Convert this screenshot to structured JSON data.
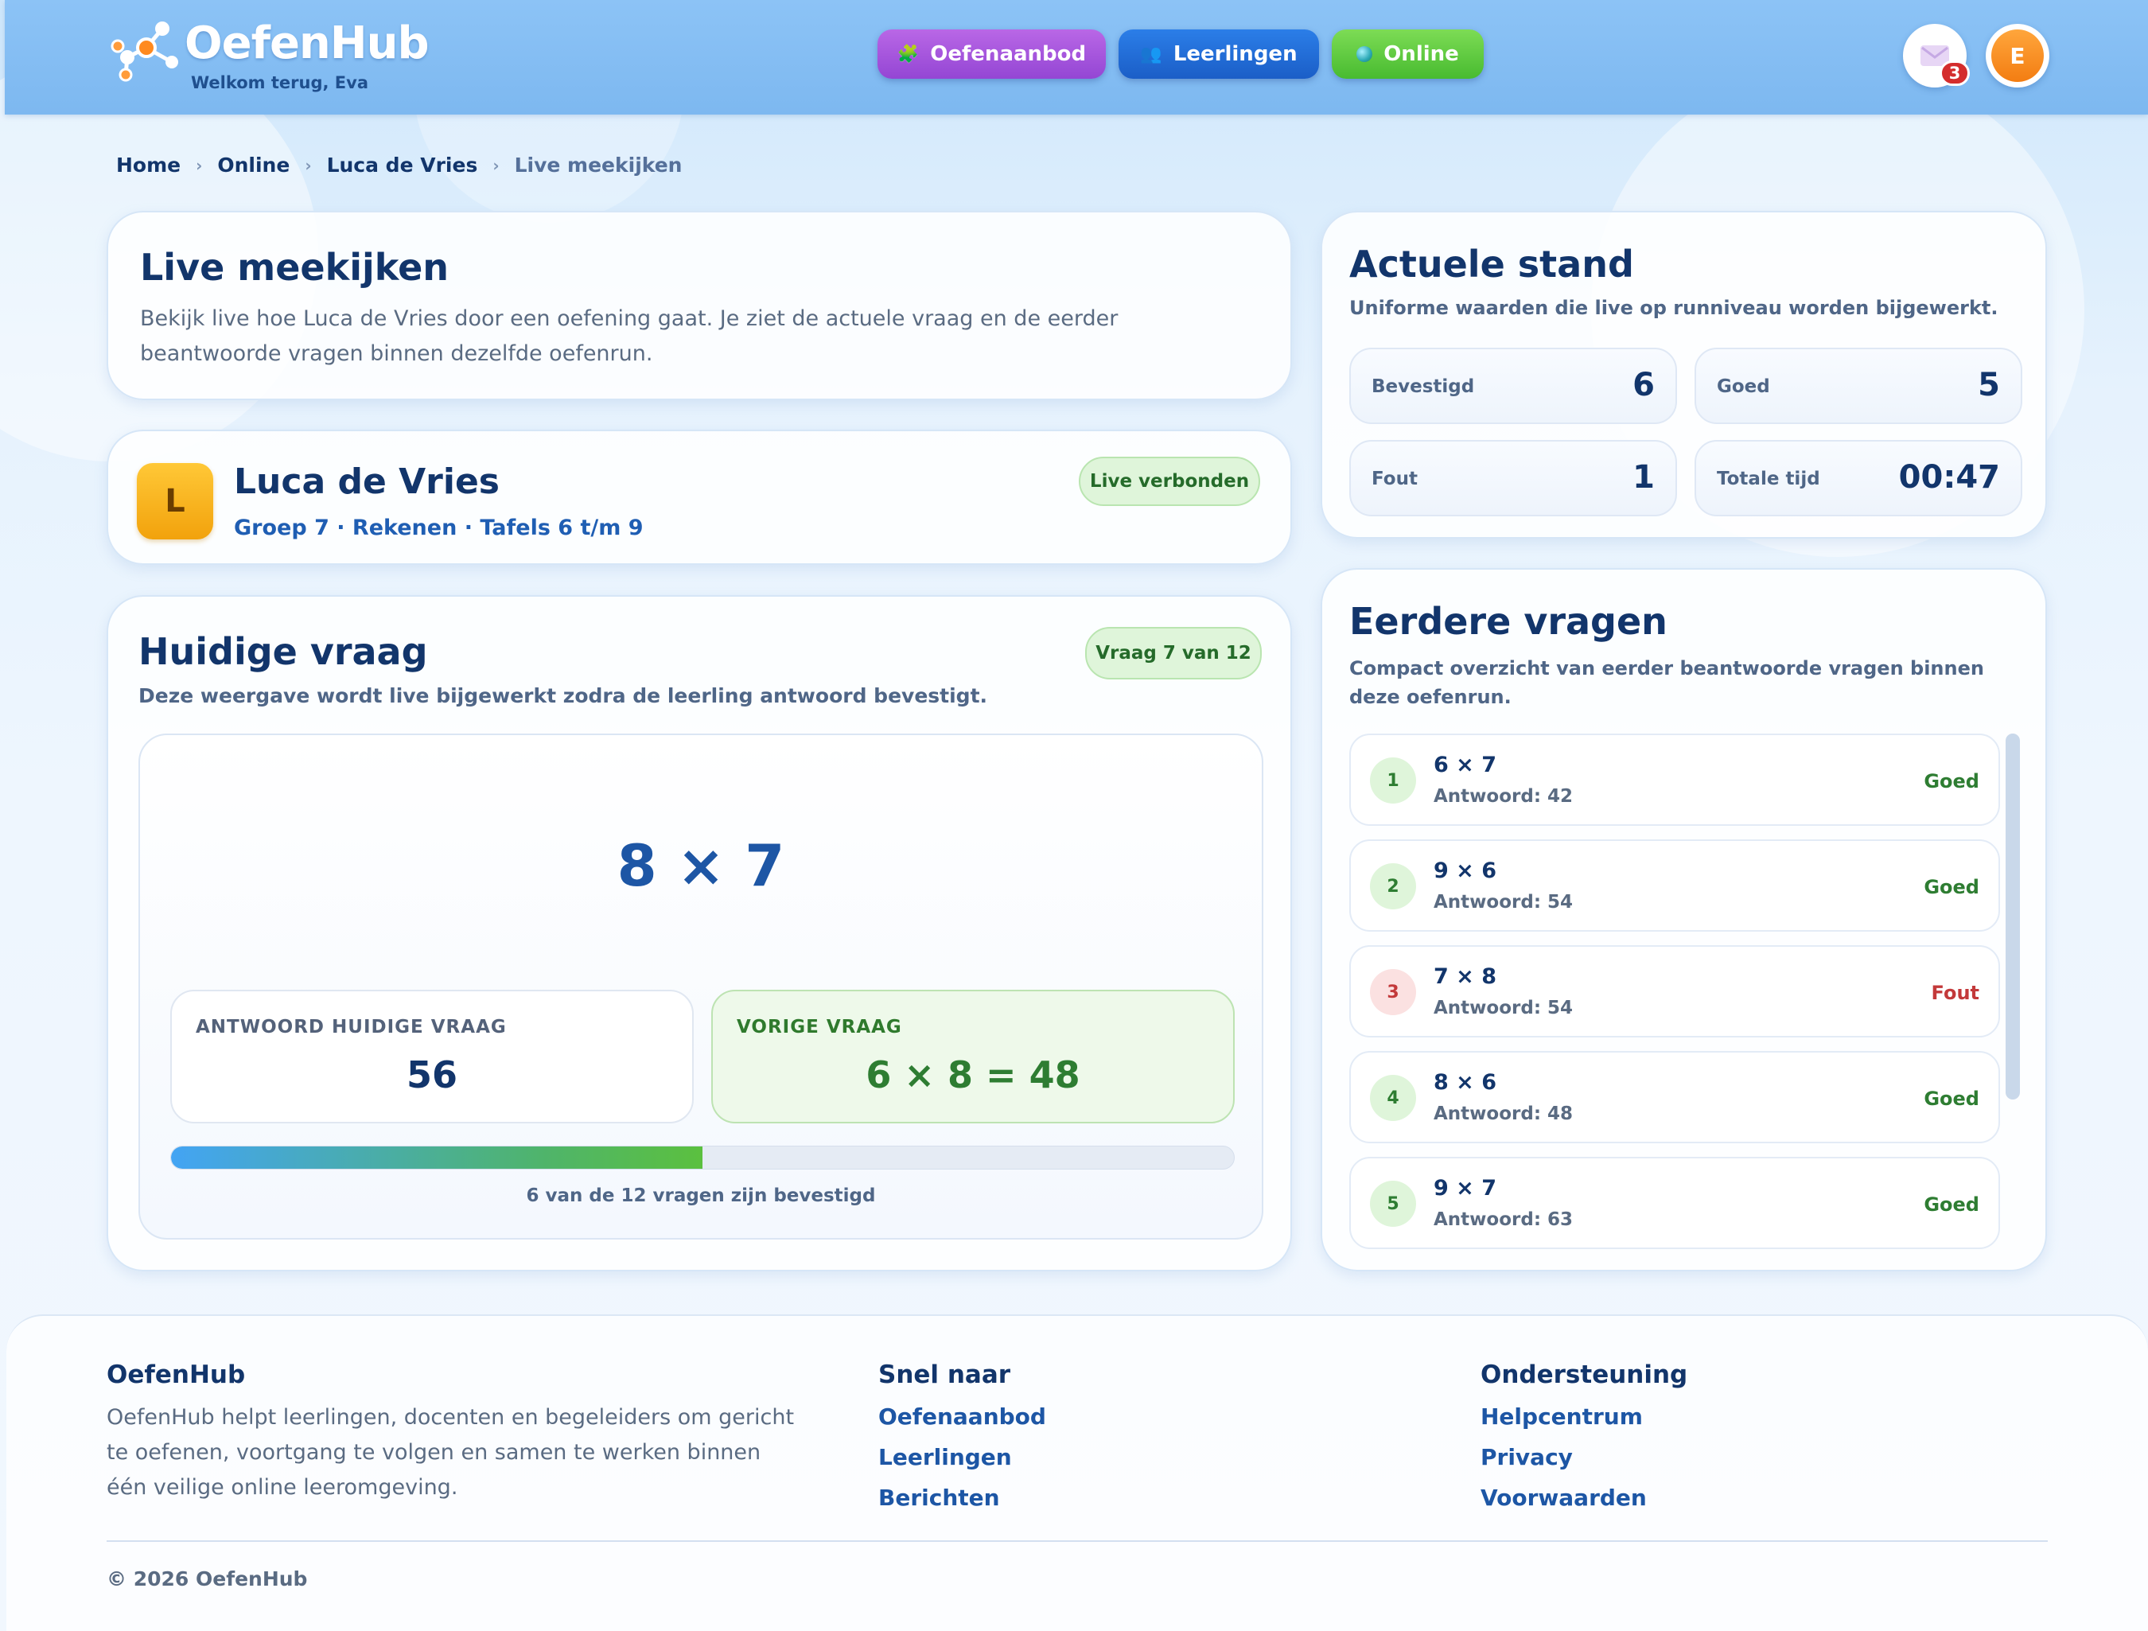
{
  "header": {
    "brand": "OefenHub",
    "welcome": "Welkom terug, Eva",
    "nav": [
      {
        "label": "Oefenaanbod",
        "icon": "puzzle-icon"
      },
      {
        "label": "Leerlingen",
        "icon": "people-icon"
      },
      {
        "label": "Online",
        "icon": "online-dot-icon"
      }
    ],
    "messages_count": "3",
    "avatar_initial": "E"
  },
  "breadcrumb": [
    "Home",
    "Online",
    "Luca de Vries",
    "Live meekijken"
  ],
  "intro": {
    "title": "Live meekijken",
    "text": "Bekijk live hoe Luca de Vries door een oefening gaat. Je ziet de actuele vraag en de eerder beantwoorde vragen binnen dezelfde oefenrun."
  },
  "student": {
    "initial": "L",
    "name": "Luca de Vries",
    "meta": "Groep 7 · Rekenen · Tafels 6 t/m 9",
    "status": "Live verbonden"
  },
  "current_question": {
    "title": "Huidige vraag",
    "subtitle": "Deze weergave wordt live bijgewerkt zodra de leerling antwoord bevestigt.",
    "counter": "Vraag 7 van 12",
    "expression": "8 × 7",
    "answer_label": "ANTWOORD HUIDIGE VRAAG",
    "answer_value": "56",
    "previous_label": "VORIGE VRAAG",
    "previous_value": "6 × 8 = 48",
    "progress_fraction": 0.5,
    "progress_text": "6 van de 12 vragen zijn bevestigd"
  },
  "standing": {
    "title": "Actuele stand",
    "subtitle": "Uniforme waarden die live op runniveau worden bijgewerkt.",
    "stats": [
      {
        "label": "Bevestigd",
        "value": "6"
      },
      {
        "label": "Goed",
        "value": "5"
      },
      {
        "label": "Fout",
        "value": "1"
      },
      {
        "label": "Totale tijd",
        "value": "00:47"
      }
    ]
  },
  "earlier": {
    "title": "Eerdere vragen",
    "subtitle": "Compact overzicht van eerder beantwoorde vragen binnen deze oefenrun.",
    "items": [
      {
        "num": "1",
        "expr": "6 × 7",
        "answer": "Antwoord: 42",
        "status": "Goed",
        "correct": true
      },
      {
        "num": "2",
        "expr": "9 × 6",
        "answer": "Antwoord: 54",
        "status": "Goed",
        "correct": true
      },
      {
        "num": "3",
        "expr": "7 × 8",
        "answer": "Antwoord: 54",
        "status": "Fout",
        "correct": false
      },
      {
        "num": "4",
        "expr": "8 × 6",
        "answer": "Antwoord: 48",
        "status": "Goed",
        "correct": true
      },
      {
        "num": "5",
        "expr": "9 × 7",
        "answer": "Antwoord: 63",
        "status": "Goed",
        "correct": true
      }
    ]
  },
  "footer": {
    "brand_title": "OefenHub",
    "description": "OefenHub helpt leerlingen, docenten en begeleiders om gericht te oefenen, voortgang te volgen en samen te werken binnen één veilige online leeromgeving.",
    "quick_title": "Snel naar",
    "quick_links": [
      "Oefenaanbod",
      "Leerlingen",
      "Berichten"
    ],
    "support_title": "Ondersteuning",
    "support_links": [
      "Helpcentrum",
      "Privacy",
      "Voorwaarden"
    ],
    "copyright": "© 2026 OefenHub"
  }
}
